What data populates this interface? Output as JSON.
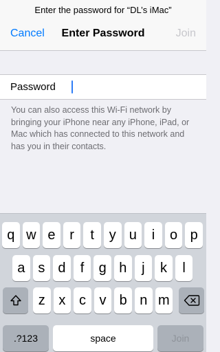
{
  "header": {
    "prompt": "Enter the password for “DL’s iMac”",
    "cancel_label": "Cancel",
    "title": "Enter Password",
    "join_label": "Join"
  },
  "password_field": {
    "label": "Password",
    "value": "",
    "placeholder": ""
  },
  "info_text": "You can also access this Wi-Fi network by bringing your iPhone near any iPhone, iPad, or Mac which has connected to this network and has you in their contacts.",
  "keyboard": {
    "row1": [
      "q",
      "w",
      "e",
      "r",
      "t",
      "y",
      "u",
      "i",
      "o",
      "p"
    ],
    "row2": [
      "a",
      "s",
      "d",
      "f",
      "g",
      "h",
      "j",
      "k",
      "l"
    ],
    "row3": [
      "z",
      "x",
      "c",
      "v",
      "b",
      "n",
      "m"
    ],
    "numbers_label": ".?123",
    "space_label": "space",
    "join_label": "Join",
    "shift_icon": "shift-icon",
    "backspace_icon": "backspace-icon"
  },
  "colors": {
    "accent": "#007aff",
    "disabled": "#c7c7cc",
    "caret": "#2d7cf6",
    "keyboard_bg": "#d1d5db",
    "function_key": "#abb1b9"
  }
}
